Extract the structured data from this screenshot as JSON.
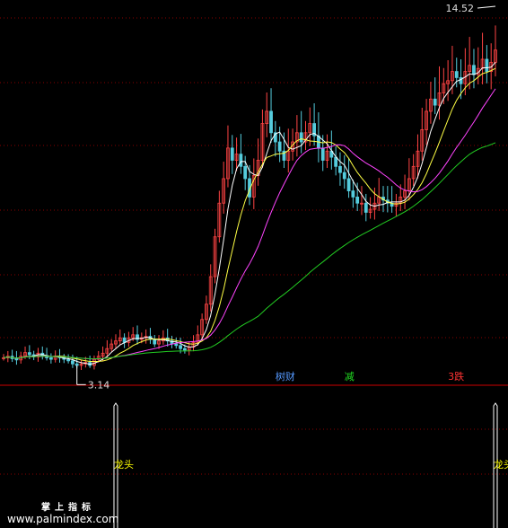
{
  "chart_data": [
    {
      "type": "line",
      "panel": "price",
      "title": "",
      "xlabel": "",
      "ylabel": "",
      "ylim": [
        2.8,
        15.0
      ],
      "grid": true,
      "high_label": "14.52",
      "low_label": "3.14",
      "signals": [
        {
          "text": "树财",
          "color": "#5599ff",
          "day": 63
        },
        {
          "text": "减",
          "color": "#22dd22",
          "day": 79
        },
        {
          "text": "3跌",
          "color": "#ff3333",
          "day": 103
        }
      ],
      "candles_close": [
        3.55,
        3.6,
        3.52,
        3.48,
        3.6,
        3.72,
        3.65,
        3.58,
        3.7,
        3.62,
        3.55,
        3.5,
        3.6,
        3.55,
        3.5,
        3.45,
        3.35,
        3.3,
        3.35,
        3.4,
        3.3,
        3.5,
        3.6,
        3.7,
        3.85,
        4.0,
        4.1,
        4.2,
        4.05,
        4.2,
        4.3,
        4.15,
        4.2,
        4.25,
        4.15,
        4.0,
        4.1,
        4.2,
        4.1,
        4.0,
        3.95,
        3.85,
        3.8,
        3.9,
        4.05,
        4.3,
        4.8,
        5.3,
        6.2,
        7.5,
        8.6,
        9.4,
        10.4,
        10.0,
        10.2,
        9.8,
        9.4,
        8.8,
        9.5,
        10.0,
        11.2,
        11.6,
        10.9,
        10.6,
        10.3,
        10.0,
        10.3,
        10.6,
        10.9,
        10.6,
        10.9,
        11.2,
        10.8,
        10.4,
        10.0,
        10.3,
        10.1,
        9.8,
        9.6,
        9.4,
        9.0,
        8.8,
        8.6,
        8.6,
        8.3,
        8.4,
        8.6,
        8.8,
        8.7,
        8.6,
        8.5,
        8.6,
        8.8,
        9.0,
        9.4,
        9.8,
        10.3,
        11.0,
        11.6,
        12.0,
        11.8,
        12.2,
        12.5,
        12.6,
        12.9,
        12.7,
        12.5,
        12.9,
        13.1,
        12.8,
        13.0,
        13.3,
        12.9,
        13.2,
        13.6
      ]
    },
    {
      "type": "bar",
      "panel": "indicator",
      "title": "",
      "signal_label": "龙头",
      "signals_at": [
        26,
        114
      ]
    }
  ],
  "watermark": {
    "title": "掌上指标",
    "url": "www.palmindex.com"
  },
  "colors": {
    "background": "#000000",
    "grid": "#880000",
    "separator": "#cc0000",
    "up": "#ff4444",
    "down": "#55ccdd",
    "ma5": "#ffffff",
    "ma10": "#ffff44",
    "ma20": "#ff44ff",
    "ma60": "#22cc22",
    "signal": "#ffffff",
    "signal_label": "#ffff00"
  }
}
